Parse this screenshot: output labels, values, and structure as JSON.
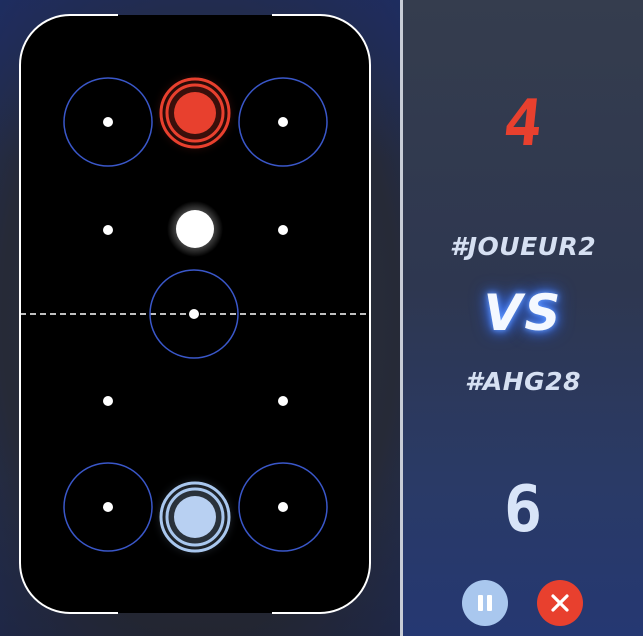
{
  "scoreboard": {
    "top_score": "4",
    "player_top": "#JOUEUR2",
    "vs_label": "VS",
    "player_bottom": "#AHG28",
    "bottom_score": "6"
  },
  "controls": {
    "pause_icon": "pause-icon",
    "close_icon": "close-icon"
  },
  "colors": {
    "opponent": "#e8402e",
    "player": "#a9c7ee",
    "rink_lines": "#3a57c9",
    "puck": "#ffffff",
    "table": "#000000"
  }
}
